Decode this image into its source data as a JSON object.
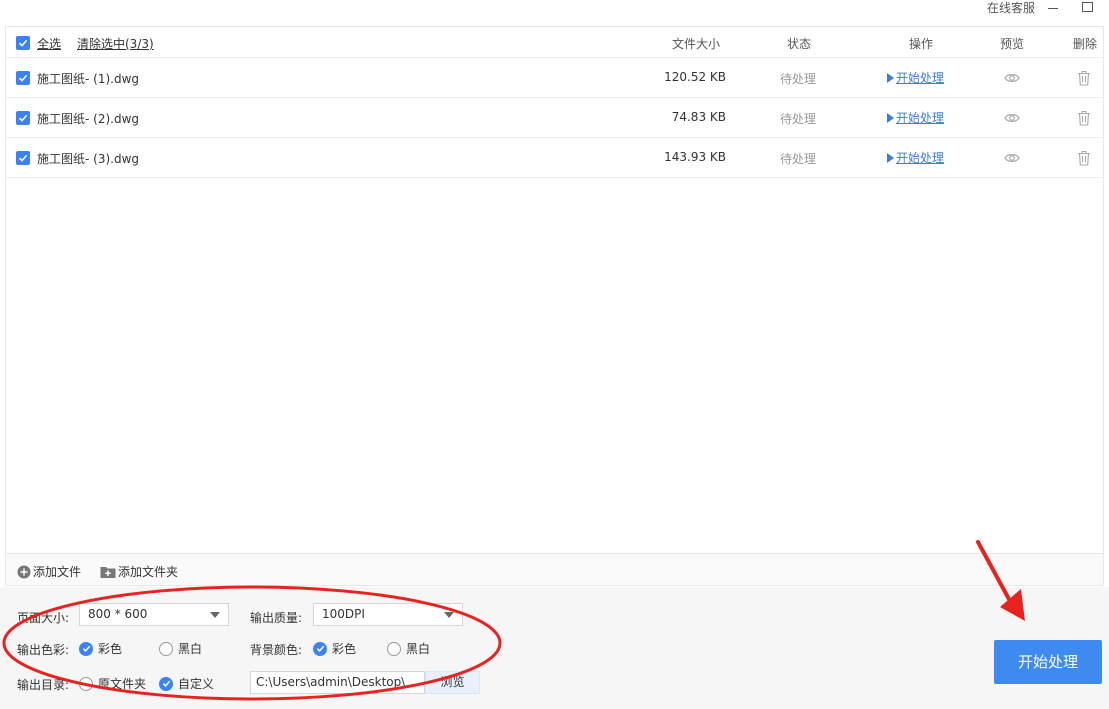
{
  "titlebar": {
    "service": "在线客服"
  },
  "header": {
    "select_all": "全选",
    "clear_selected": "清除选中(3/3)",
    "col_size": "文件大小",
    "col_status": "状态",
    "col_action": "操作",
    "col_preview": "预览",
    "col_delete": "删除"
  },
  "files": [
    {
      "name": "施工图纸- (1).dwg",
      "size": "120.52 KB",
      "status": "待处理",
      "action": "开始处理"
    },
    {
      "name": "施工图纸- (2).dwg",
      "size": "74.83 KB",
      "status": "待处理",
      "action": "开始处理"
    },
    {
      "name": "施工图纸- (3).dwg",
      "size": "143.93 KB",
      "status": "待处理",
      "action": "开始处理"
    }
  ],
  "addbar": {
    "add_file": "添加文件",
    "add_folder": "添加文件夹"
  },
  "settings": {
    "page_size_label": "页面大小:",
    "page_size_value": "800 * 600",
    "quality_label": "输出质量:",
    "quality_value": "100DPI",
    "color_label": "输出色彩:",
    "color_options": [
      "彩色",
      "黑白"
    ],
    "bg_label": "背景颜色:",
    "bg_options": [
      "彩色",
      "黑白"
    ],
    "dir_label": "输出目录:",
    "dir_options": [
      "原文件夹",
      "自定义"
    ],
    "dir_path": "C:\\Users\\admin\\Desktop\\",
    "browse": "浏览"
  },
  "start_button": "开始处理",
  "colors": {
    "accent": "#3b82f6",
    "annotation": "#e8231f"
  }
}
